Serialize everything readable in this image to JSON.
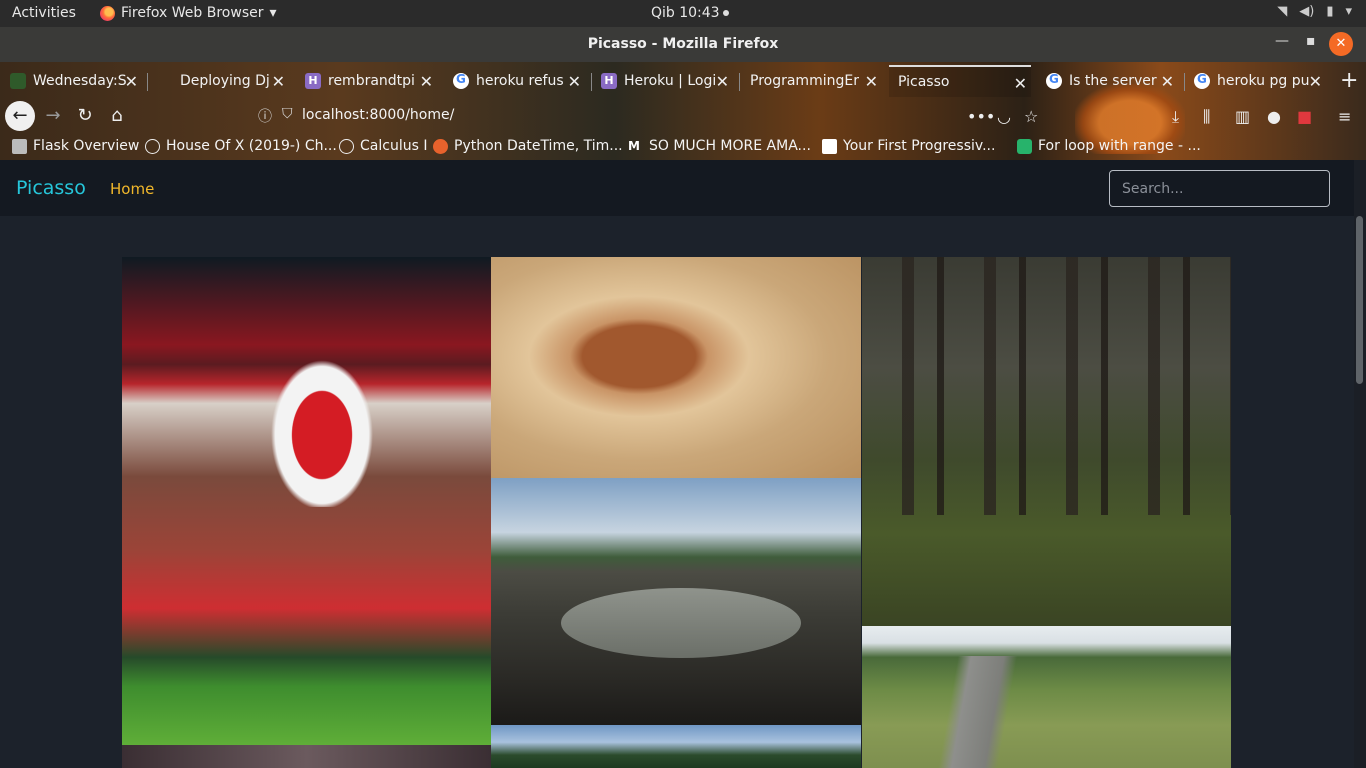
{
  "gnome": {
    "activities": "Activities",
    "app_menu": "Firefox Web Browser",
    "clock": "Qib 10:43"
  },
  "window": {
    "title": "Picasso - Mozilla Firefox"
  },
  "tabs": [
    {
      "label": "Wednesday:S",
      "icon": "tree-favicon"
    },
    {
      "label": "Deploying Dj",
      "icon": "github-favicon"
    },
    {
      "label": "rembrandtpi",
      "icon": "heroku-favicon"
    },
    {
      "label": "heroku refus",
      "icon": "google-favicon"
    },
    {
      "label": "Heroku | Logi",
      "icon": "heroku-favicon"
    },
    {
      "label": "ProgrammingEr",
      "icon": "none"
    },
    {
      "label": "Picasso",
      "icon": "none",
      "active": true
    },
    {
      "label": "Is the server",
      "icon": "google-favicon"
    },
    {
      "label": "heroku pg pu",
      "icon": "google-favicon"
    }
  ],
  "nav": {
    "url": "localhost:8000/home/",
    "overflow_icon": "•••"
  },
  "bookmarks": [
    {
      "label": "Flask Overview",
      "icon": "site-favicon"
    },
    {
      "label": "House Of X (2019-) Ch...",
      "icon": "globe-icon"
    },
    {
      "label": "Calculus I",
      "icon": "globe-icon"
    },
    {
      "label": "Python DateTime, Tim...",
      "icon": "orange-favicon"
    },
    {
      "label": "SO MUCH MORE AMA...",
      "icon": "medium-favicon"
    },
    {
      "label": "Your First Progressiv...",
      "icon": "google-dev-favicon"
    },
    {
      "label": "For loop with range - ...",
      "icon": "loop-favicon"
    }
  ],
  "site": {
    "brand": "Picasso",
    "home_link": "Home",
    "search_placeholder": "Search..."
  },
  "gallery": [
    {
      "name": "football-celebration"
    },
    {
      "name": "da-vinci-fetus-drawing"
    },
    {
      "name": "fish-island-surreal"
    },
    {
      "name": "lake-landscape"
    },
    {
      "name": "forest-man-ground"
    },
    {
      "name": "road-carpet-surreal"
    },
    {
      "name": "bottom-partial-image"
    }
  ],
  "colors": {
    "brand": "#26c6da",
    "home_link": "#f1b72b",
    "navbar_bg": "#141921",
    "page_bg": "#1c222b"
  }
}
